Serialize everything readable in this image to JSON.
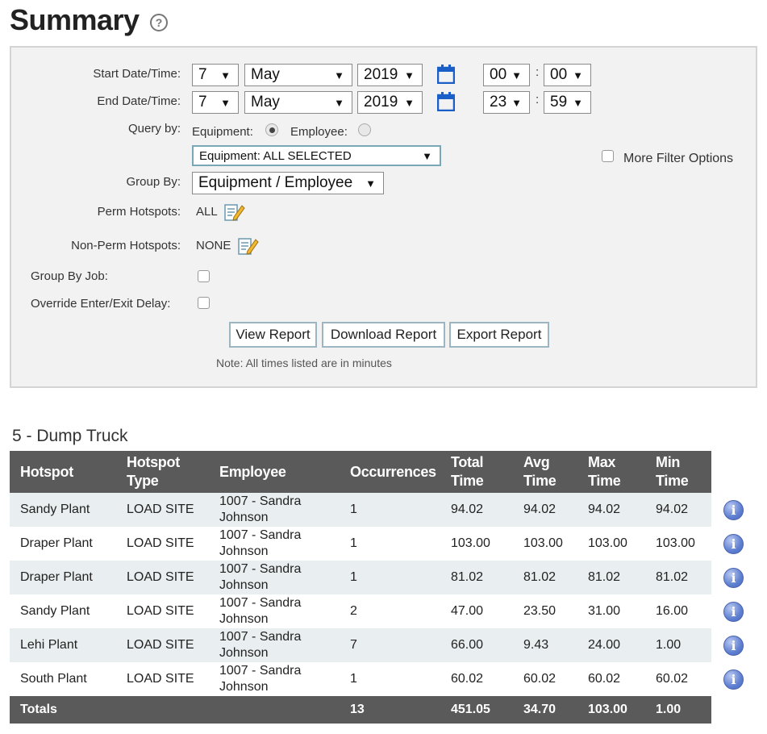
{
  "page": {
    "title": "Summary",
    "help_icon": "?"
  },
  "filters": {
    "start_label": "Start Date/Time:",
    "end_label": "End Date/Time:",
    "start": {
      "day": "7",
      "month": "May",
      "year": "2019",
      "hour": "00",
      "minute": "00"
    },
    "end": {
      "day": "7",
      "month": "May",
      "year": "2019",
      "hour": "23",
      "minute": "59"
    },
    "time_sep": ":",
    "query_by_label": "Query by:",
    "query_equipment_label": "Equipment:",
    "query_employee_label": "Employee:",
    "query_selected": "equipment",
    "equipment_select": "Equipment: ALL SELECTED",
    "more_filter_options": "More Filter Options",
    "group_by_label": "Group By:",
    "group_by_value": "Equipment / Employee",
    "perm_hotspots_label": "Perm Hotspots:",
    "perm_hotspots_value": "ALL",
    "nonperm_hotspots_label": "Non-Perm Hotspots:",
    "nonperm_hotspots_value": "NONE",
    "group_by_job_label": "Group By Job:",
    "override_delay_label": "Override Enter/Exit Delay:",
    "view_report": "View Report",
    "download_report": "Download Report",
    "export_report": "Export Report",
    "note": "Note: All times listed are in minutes"
  },
  "report": {
    "section_title": "5 - Dump Truck",
    "columns": [
      "Hotspot",
      "Hotspot Type",
      "Employee",
      "Occurrences",
      "Total Time",
      "Avg Time",
      "Max Time",
      "Min Time"
    ],
    "rows": [
      [
        "Sandy Plant",
        "LOAD SITE",
        "1007 - Sandra Johnson",
        "1",
        "94.02",
        "94.02",
        "94.02",
        "94.02"
      ],
      [
        "Draper Plant",
        "LOAD SITE",
        "1007 - Sandra Johnson",
        "1",
        "103.00",
        "103.00",
        "103.00",
        "103.00"
      ],
      [
        "Draper Plant",
        "LOAD SITE",
        "1007 - Sandra Johnson",
        "1",
        "81.02",
        "81.02",
        "81.02",
        "81.02"
      ],
      [
        "Sandy Plant",
        "LOAD SITE",
        "1007 - Sandra Johnson",
        "2",
        "47.00",
        "23.50",
        "31.00",
        "16.00"
      ],
      [
        "Lehi Plant",
        "LOAD SITE",
        "1007 - Sandra Johnson",
        "7",
        "66.00",
        "9.43",
        "24.00",
        "1.00"
      ],
      [
        "South Plant",
        "LOAD SITE",
        "1007 - Sandra Johnson",
        "1",
        "60.02",
        "60.02",
        "60.02",
        "60.02"
      ]
    ],
    "totals": [
      "Totals",
      "",
      "",
      "13",
      "451.05",
      "34.70",
      "103.00",
      "1.00"
    ],
    "info_icon_glyph": "i"
  },
  "colors": {
    "header_bg": "#5a5a5a",
    "accent_blue": "#1a5fc8",
    "stripe": "#e9eef0"
  }
}
